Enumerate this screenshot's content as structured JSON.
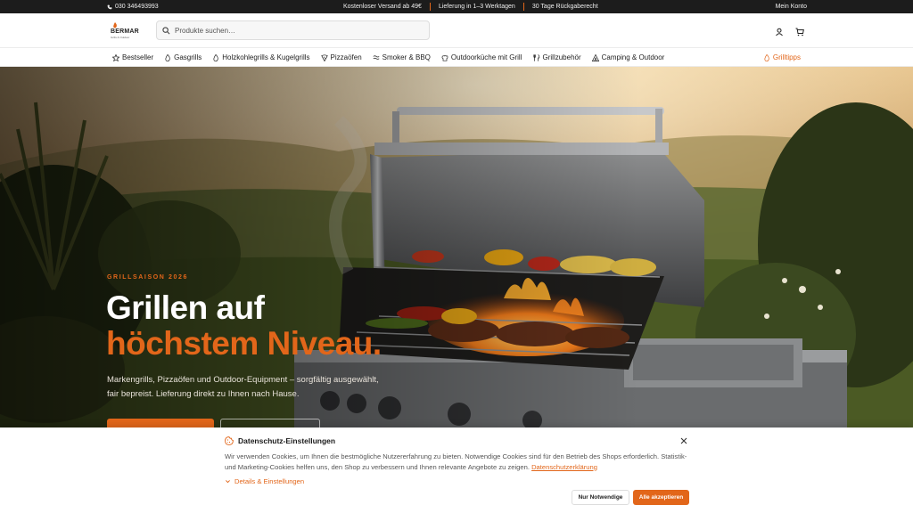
{
  "topbar": {
    "phone": "030 346493993",
    "shipping": "Kostenloser Versand ab 49€",
    "delivery": "Lieferung in 1–3 Werktagen",
    "returns": "30 Tage Rückgaberecht",
    "account": "Mein Konto"
  },
  "header": {
    "logo_text": "BERMAR",
    "logo_sub": "Grills & Outdoor",
    "search_placeholder": "Produkte suchen…"
  },
  "nav": {
    "items": [
      {
        "label": "Bestseller",
        "icon": "star-icon"
      },
      {
        "label": "Gasgrills",
        "icon": "flame-icon"
      },
      {
        "label": "Holzkohlegrills & Kugelgrills",
        "icon": "flame-icon"
      },
      {
        "label": "Pizzaöfen",
        "icon": "pizza-icon"
      },
      {
        "label": "Smoker & BBQ",
        "icon": "smoke-icon"
      },
      {
        "label": "Outdoorküche mit Grill",
        "icon": "chef-hat-icon"
      },
      {
        "label": "Grillzubehör",
        "icon": "utensils-icon"
      },
      {
        "label": "Camping & Outdoor",
        "icon": "tent-icon"
      }
    ],
    "tips": "Grilltipps"
  },
  "hero": {
    "kicker": "GRILLSAISON 2026",
    "headline_1": "Grillen auf",
    "headline_2": "höchstem Niveau.",
    "description": "Markengrills, Pizzaöfen und Outdoor-Equipment – sorgfältig ausgewählt, fair bepreist. Lieferung direkt zu Ihnen nach Hause."
  },
  "cookie": {
    "title": "Datenschutz-Einstellungen",
    "text": "Wir verwenden Cookies, um Ihnen die bestmögliche Nutzererfahrung zu bieten. Notwendige Cookies sind für den Betrieb des Shops erforderlich. Statistik- und Marketing-Cookies helfen uns, den Shop zu verbessern und Ihnen relevante Angebote zu zeigen.",
    "privacy_link": "Datenschutzerklärung",
    "details": "Details & Einstellungen",
    "btn_necessary": "Nur Notwendige",
    "btn_accept_all": "Alle akzeptieren"
  },
  "colors": {
    "accent": "#e2661a",
    "topbar_bg": "#1c1c1c"
  }
}
